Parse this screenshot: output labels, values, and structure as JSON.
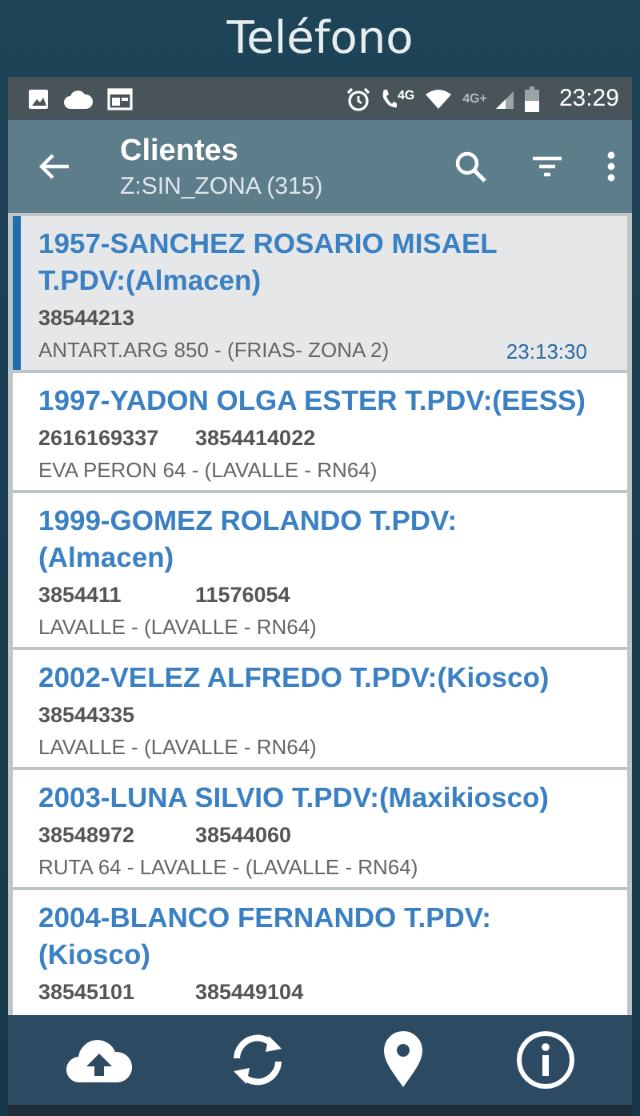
{
  "screen_title": "Teléfono",
  "status_bar": {
    "call_network": "4G",
    "network": "4G+",
    "time": "23:29"
  },
  "app_bar": {
    "title": "Clientes",
    "subtitle": "Z:SIN_ZONA (315)"
  },
  "clients": [
    {
      "name": "1957-SANCHEZ ROSARIO MISAEL T.PDV:(Almacen)",
      "phones": [
        "38544213"
      ],
      "address": "ANTART.ARG 850 - (FRIAS- ZONA 2)",
      "time": "23:13:30",
      "selected": true
    },
    {
      "name": "1997-YADON OLGA ESTER T.PDV:(EESS)",
      "phones": [
        "2616169337",
        "3854414022"
      ],
      "address": "EVA PERON 64 - (LAVALLE - RN64)",
      "selected": false
    },
    {
      "name": "1999-GOMEZ ROLANDO T.PDV: (Almacen)",
      "phones": [
        "3854411",
        "11576054"
      ],
      "address": "LAVALLE - (LAVALLE - RN64)",
      "selected": false
    },
    {
      "name": "2002-VELEZ ALFREDO T.PDV:(Kiosco)",
      "phones": [
        "38544335"
      ],
      "address": "LAVALLE - (LAVALLE - RN64)",
      "selected": false
    },
    {
      "name": "2003-LUNA SILVIO T.PDV:(Maxikiosco)",
      "phones": [
        "38548972",
        "38544060"
      ],
      "address": "RUTA 64 - LAVALLE - (LAVALLE - RN64)",
      "selected": false
    },
    {
      "name": "2004-BLANCO FERNANDO T.PDV: (Kiosco)",
      "phones": [
        "38545101",
        "385449104"
      ],
      "selected": false
    }
  ]
}
